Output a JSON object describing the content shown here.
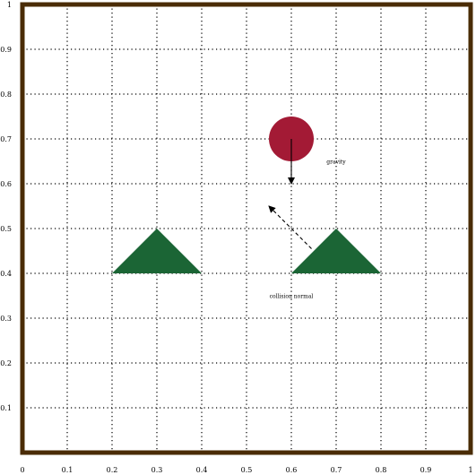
{
  "chart_data": {
    "type": "diagram",
    "xlim": [
      0,
      1
    ],
    "ylim": [
      0,
      1
    ],
    "grid": true,
    "x_ticks": [
      "0",
      "0.1",
      "0.2",
      "0.3",
      "0.4",
      "0.5",
      "0.6",
      "0.7",
      "0.8",
      "0.9",
      "1"
    ],
    "y_ticks": [
      "0",
      "0.1",
      "0.2",
      "0.3",
      "0.4",
      "0.5",
      "0.6",
      "0.7",
      "0.8",
      "0.9",
      "1"
    ],
    "border_color": "#4a2c06",
    "shapes": [
      {
        "kind": "circle",
        "name": "ball",
        "center": [
          0.6,
          0.7
        ],
        "radius": 0.05,
        "color": "#a31a35"
      },
      {
        "kind": "triangle",
        "name": "triangle-left",
        "points": [
          [
            0.2,
            0.4
          ],
          [
            0.3,
            0.5
          ],
          [
            0.4,
            0.4
          ]
        ],
        "color": "#1b6535"
      },
      {
        "kind": "triangle",
        "name": "triangle-right",
        "points": [
          [
            0.6,
            0.4
          ],
          [
            0.7,
            0.5
          ],
          [
            0.8,
            0.4
          ]
        ],
        "color": "#1b6535"
      }
    ],
    "arrows": [
      {
        "name": "gravity-arrow",
        "from": [
          0.6,
          0.7
        ],
        "to": [
          0.6,
          0.6
        ],
        "style": "solid"
      },
      {
        "name": "collision-normal-arrow",
        "from": [
          0.645,
          0.455
        ],
        "to": [
          0.55,
          0.55
        ],
        "style": "dashed"
      }
    ],
    "annotations": [
      {
        "name": "gravity-label",
        "text": "gravity",
        "at": [
          0.7,
          0.645
        ]
      },
      {
        "name": "collision-normal-label",
        "text": "collision normal",
        "at": [
          0.6,
          0.345
        ]
      }
    ]
  }
}
